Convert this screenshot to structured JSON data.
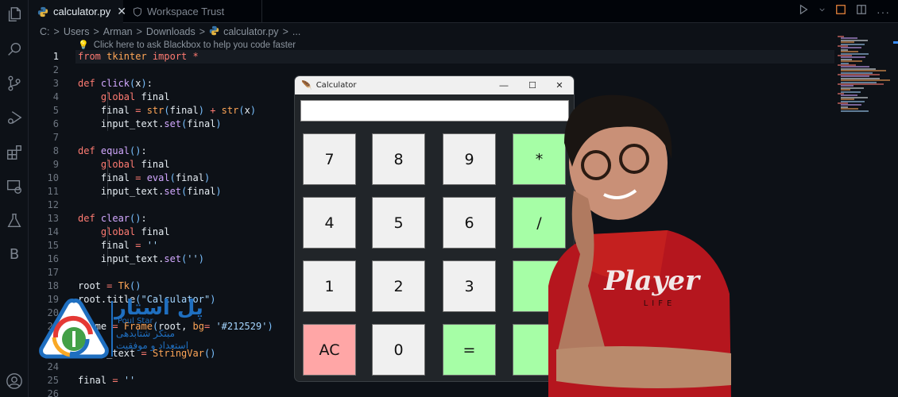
{
  "activity_bar": {
    "items": [
      {
        "name": "explorer",
        "icon": "files-icon"
      },
      {
        "name": "search",
        "icon": "search-icon"
      },
      {
        "name": "source-control",
        "icon": "git-branch-icon"
      },
      {
        "name": "run-debug",
        "icon": "run-debug-icon"
      },
      {
        "name": "extensions",
        "icon": "extensions-icon"
      },
      {
        "name": "remote-explorer",
        "icon": "remote-icon"
      },
      {
        "name": "testing",
        "icon": "flask-icon"
      },
      {
        "name": "blackbox",
        "icon": "b-icon",
        "label": "B"
      },
      {
        "name": "accounts",
        "icon": "account-icon"
      }
    ]
  },
  "tabs": [
    {
      "label": "calculator.py",
      "active": true,
      "icon": "python-icon",
      "close": "✕"
    },
    {
      "label": "Workspace Trust",
      "active": false,
      "icon": "shield-icon"
    }
  ],
  "breadcrumb": {
    "items": [
      "C:",
      "Users",
      "Arman",
      "Downloads",
      "calculator.py",
      "..."
    ],
    "separator": ">"
  },
  "hint": {
    "icon": "lightbulb-icon",
    "text": "Click here to ask Blackbox to help you code faster"
  },
  "editor": {
    "current_line": 1,
    "lines": [
      {
        "n": "1",
        "tokens": [
          [
            "kw",
            "from "
          ],
          [
            "bi",
            "tkinter "
          ],
          [
            "kw",
            "import "
          ],
          [
            "op",
            "*"
          ]
        ]
      },
      {
        "n": "2",
        "tokens": []
      },
      {
        "n": "3",
        "tokens": [
          [
            "kw",
            "def "
          ],
          [
            "fn",
            "click"
          ],
          [
            "paren",
            "("
          ],
          [
            "plain",
            "x"
          ],
          [
            "paren",
            ")"
          ],
          [
            "plain",
            ":"
          ]
        ]
      },
      {
        "n": "4",
        "tokens": [
          [
            "plain",
            "    "
          ],
          [
            "kw",
            "global "
          ],
          [
            "plain",
            "final"
          ]
        ]
      },
      {
        "n": "5",
        "tokens": [
          [
            "plain",
            "    final "
          ],
          [
            "op",
            "= "
          ],
          [
            "bi",
            "str"
          ],
          [
            "paren",
            "("
          ],
          [
            "plain",
            "final"
          ],
          [
            "paren",
            ")"
          ],
          [
            "op",
            " + "
          ],
          [
            "bi",
            "str"
          ],
          [
            "paren",
            "("
          ],
          [
            "plain",
            "x"
          ],
          [
            "paren",
            ")"
          ]
        ]
      },
      {
        "n": "6",
        "tokens": [
          [
            "plain",
            "    input_text."
          ],
          [
            "fn",
            "set"
          ],
          [
            "paren",
            "("
          ],
          [
            "plain",
            "final"
          ],
          [
            "paren",
            ")"
          ]
        ]
      },
      {
        "n": "7",
        "tokens": []
      },
      {
        "n": "8",
        "tokens": [
          [
            "kw",
            "def "
          ],
          [
            "fn",
            "equal"
          ],
          [
            "paren",
            "()"
          ],
          [
            "plain",
            ":"
          ]
        ]
      },
      {
        "n": "9",
        "tokens": [
          [
            "plain",
            "    "
          ],
          [
            "kw",
            "global "
          ],
          [
            "plain",
            "final"
          ]
        ]
      },
      {
        "n": "10",
        "tokens": [
          [
            "plain",
            "    final "
          ],
          [
            "op",
            "= "
          ],
          [
            "fn",
            "eval"
          ],
          [
            "paren",
            "("
          ],
          [
            "plain",
            "final"
          ],
          [
            "paren",
            ")"
          ]
        ]
      },
      {
        "n": "11",
        "tokens": [
          [
            "plain",
            "    input_text."
          ],
          [
            "fn",
            "set"
          ],
          [
            "paren",
            "("
          ],
          [
            "plain",
            "final"
          ],
          [
            "paren",
            ")"
          ]
        ]
      },
      {
        "n": "12",
        "tokens": []
      },
      {
        "n": "13",
        "tokens": [
          [
            "kw",
            "def "
          ],
          [
            "fn",
            "clear"
          ],
          [
            "paren",
            "()"
          ],
          [
            "plain",
            ":"
          ]
        ]
      },
      {
        "n": "14",
        "tokens": [
          [
            "plain",
            "    "
          ],
          [
            "kw",
            "global "
          ],
          [
            "plain",
            "final"
          ]
        ]
      },
      {
        "n": "15",
        "tokens": [
          [
            "plain",
            "    final "
          ],
          [
            "op",
            "= "
          ],
          [
            "str",
            "''"
          ]
        ]
      },
      {
        "n": "16",
        "tokens": [
          [
            "plain",
            "    input_text."
          ],
          [
            "fn",
            "set"
          ],
          [
            "paren",
            "("
          ],
          [
            "str",
            "''"
          ],
          [
            "paren",
            ")"
          ]
        ]
      },
      {
        "n": "17",
        "tokens": []
      },
      {
        "n": "18",
        "tokens": [
          [
            "plain",
            "root "
          ],
          [
            "op",
            "= "
          ],
          [
            "bi",
            "Tk"
          ],
          [
            "paren",
            "()"
          ]
        ]
      },
      {
        "n": "19",
        "tokens": [
          [
            "plain",
            "root.title"
          ],
          [
            "paren",
            "("
          ],
          [
            "str",
            "\"Calculator\""
          ],
          [
            "paren",
            ")"
          ]
        ]
      },
      {
        "n": "20",
        "tokens": []
      },
      {
        "n": "21",
        "tokens": [
          [
            "plain",
            "frame "
          ],
          [
            "op",
            "= "
          ],
          [
            "bi",
            "Frame"
          ],
          [
            "paren",
            "("
          ],
          [
            "plain",
            "root, "
          ],
          [
            "bi",
            "bg"
          ],
          [
            "op",
            "= "
          ],
          [
            "str",
            "'#212529'"
          ],
          [
            "paren",
            ")"
          ]
        ]
      },
      {
        "n": "22",
        "tokens": []
      },
      {
        "n": "23",
        "tokens": [
          [
            "plain",
            "input_text "
          ],
          [
            "op",
            "= "
          ],
          [
            "bi",
            "StringVar"
          ],
          [
            "paren",
            "()"
          ]
        ]
      },
      {
        "n": "24",
        "tokens": []
      },
      {
        "n": "25",
        "tokens": [
          [
            "plain",
            "final "
          ],
          [
            "op",
            "= "
          ],
          [
            "str",
            "''"
          ]
        ]
      },
      {
        "n": "26",
        "tokens": []
      }
    ]
  },
  "calculator_window": {
    "title": "Calculator",
    "controls": {
      "minimize": "—",
      "maximize": "☐",
      "close": "✕"
    },
    "display_value": "",
    "buttons": [
      {
        "label": "7",
        "kind": "num"
      },
      {
        "label": "8",
        "kind": "num"
      },
      {
        "label": "9",
        "kind": "num"
      },
      {
        "label": "*",
        "kind": "op"
      },
      {
        "label": "4",
        "kind": "num"
      },
      {
        "label": "5",
        "kind": "num"
      },
      {
        "label": "6",
        "kind": "num"
      },
      {
        "label": "/",
        "kind": "op"
      },
      {
        "label": "1",
        "kind": "num"
      },
      {
        "label": "2",
        "kind": "num"
      },
      {
        "label": "3",
        "kind": "num"
      },
      {
        "label": "",
        "kind": "op"
      },
      {
        "label": "AC",
        "kind": "ac"
      },
      {
        "label": "0",
        "kind": "num"
      },
      {
        "label": "=",
        "kind": "op"
      },
      {
        "label": "",
        "kind": "op"
      }
    ],
    "colors": {
      "background": "#212529",
      "number": "#f0f0f0",
      "operator": "#a6fea6",
      "clear": "#ffa6a6"
    }
  },
  "watermark": {
    "brand_fa": "پل استار",
    "brand_en": "Poul Star",
    "tagline_1": "مبتکر شتابدهی",
    "tagline_2": "استعداد و موفقیت"
  },
  "overlay": {
    "shirt_text": "Player",
    "shirt_sub": "LIFE"
  }
}
